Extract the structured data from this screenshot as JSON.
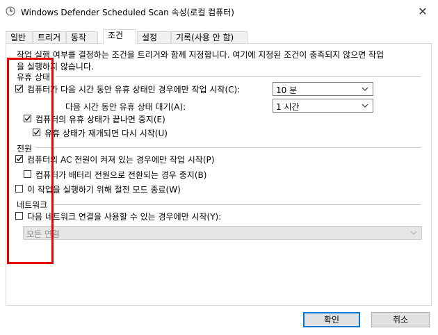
{
  "window": {
    "title": "Windows Defender Scheduled Scan 속성(로컬 컴퓨터)",
    "icon": "clock-icon",
    "close_glyph": "✕"
  },
  "tabs": [
    {
      "label": "일반"
    },
    {
      "label": "트리거"
    },
    {
      "label": "동작"
    },
    {
      "label": "조건"
    },
    {
      "label": "설정"
    },
    {
      "label": "기록(사용 안 함)"
    }
  ],
  "active_tab": "조건",
  "description_lines": [
    "작업 실행 여부를 결정하는 조건을 트리거와 함께 지정합니다. 여기에 지정된 조건이 충족되지 않으면 작업",
    "을 실행하지 않습니다."
  ],
  "idle": {
    "group_label": "유휴 상태",
    "start_only_if_idle": {
      "label": "컴퓨터가 다음 시간 동안 유휴 상태인 경우에만 작업 시작(C):",
      "checked": true
    },
    "idle_duration": {
      "value": "10 분"
    },
    "wait_for_idle": {
      "label": "다음 시간 동안 유휴 상태 대기(A):",
      "value": "1 시간"
    },
    "stop_if_not_idle": {
      "label": "컴퓨터의 유휴 상태가 끝나면 중지(E)",
      "checked": true
    },
    "restart_if_idle": {
      "label": "유휴 상태가 재개되면 다시 시작(U)",
      "checked": true
    }
  },
  "power": {
    "group_label": "전원",
    "ac_only": {
      "label": "컴퓨터의 AC 전원이 켜져 있는 경우에만 작업 시작(P)",
      "checked": true
    },
    "stop_on_battery": {
      "label": "컴퓨터가 배터리 전원으로 전환되는 경우 중지(B)",
      "checked": false
    },
    "wake_to_run": {
      "label": "이 작업을 실행하기 위해 절전 모드 종료(W)",
      "checked": false
    }
  },
  "network": {
    "group_label": "네트워크",
    "network_only": {
      "label": "다음 네트워크 연결을 사용할 수 있는 경우에만 시작(Y):",
      "checked": false
    },
    "connection": {
      "value": "모든 연결"
    }
  },
  "buttons": {
    "ok": "확인",
    "cancel": "취소"
  },
  "colors": {
    "highlight": "#e60000",
    "primary_border": "#0078d7"
  }
}
